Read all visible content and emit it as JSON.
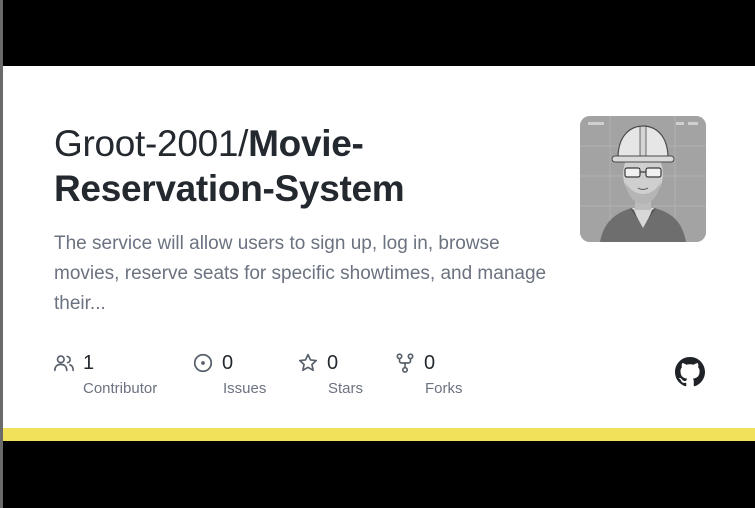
{
  "repo": {
    "owner_prefix": "Groot-2001/",
    "name": "Movie-Reservation-System",
    "description": "The service will allow users to sign up, log in, browse movies, reserve seats for specific showtimes, and manage their..."
  },
  "avatar": {
    "icon": "engineer-portrait-avatar"
  },
  "stats": {
    "contributors": {
      "count": "1",
      "label": "Contributor",
      "icon": "people-icon"
    },
    "issues": {
      "count": "0",
      "label": "Issues",
      "icon": "issue-opened-icon"
    },
    "stars": {
      "count": "0",
      "label": "Stars",
      "icon": "star-icon"
    },
    "forks": {
      "count": "0",
      "label": "Forks",
      "icon": "repo-forked-icon"
    }
  },
  "brand": {
    "logo": "github-mark-icon"
  },
  "colors": {
    "background": "#000000",
    "card": "#ffffff",
    "title": "#24292f",
    "muted": "#6b7280",
    "accent": "#f1e05a"
  }
}
